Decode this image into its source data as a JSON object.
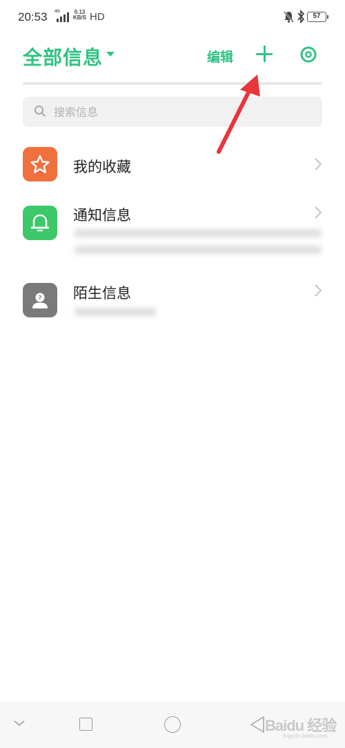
{
  "status_bar": {
    "time": "20:53",
    "network": "4G",
    "net_speed_value": "0.13",
    "net_speed_unit": "KB/S",
    "hd": "HD",
    "battery": "57"
  },
  "header": {
    "title": "全部信息",
    "edit_label": "编辑",
    "add_icon": "plus-icon",
    "settings_icon": "settings-ring-icon"
  },
  "search": {
    "placeholder": "搜索信息",
    "value": ""
  },
  "list": [
    {
      "title": "我的收藏",
      "icon": "star-icon",
      "icon_color": "#f0703e"
    },
    {
      "title": "通知信息",
      "icon": "bell-icon",
      "icon_color": "#3dc86a"
    },
    {
      "title": "陌生信息",
      "icon": "stranger-icon",
      "icon_color": "#7a7a7a"
    }
  ],
  "watermark": {
    "text": "Baidu 经验",
    "sub": "jingyan.baidu.com"
  },
  "colors": {
    "accent": "#2fc382",
    "annotation_arrow": "#e8363a"
  }
}
